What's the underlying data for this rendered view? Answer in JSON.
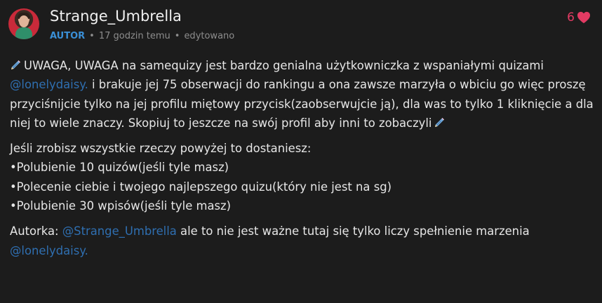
{
  "post": {
    "author": "Strange_Umbrella",
    "role": "AUTOR",
    "time": "17 godzin temu",
    "edited": "edytowano",
    "likes": "6",
    "icons": {
      "like": "heart-icon",
      "decoration": "pencil-icon"
    },
    "colors": {
      "background": "#1c1c1c",
      "mention": "#2f6fb1",
      "role": "#3a8fd6",
      "like": "#e23b63"
    },
    "paragraph1": {
      "text1": "UWAGA, UWAGA na samequizy jest bardzo genialna użytkowniczka z wspaniałymi quizami ",
      "mention": "@lonelydaisy.",
      "text2": " i brakuje jej 75 obserwacji do rankingu a ona zawsze marzyła o wbiciu go więc proszę przyciśnijcie tylko na jej profilu miętowy przycisk(zaobserwujcie ją), dla was to tylko 1 kliknięcie a dla niej to wiele znaczy. Skopiuj to jeszcze na swój profil aby inni to zobaczyli"
    },
    "paragraph2": {
      "intro": "Jeśli zrobisz wszystkie rzeczy powyżej to dostaniesz:",
      "bullets": [
        "•Polubienie 10 quizów(jeśli tyle masz)",
        "•Polecenie ciebie i twojego najlepszego quizu(który nie jest na sg)",
        "•Polubienie 30 wpisów(jeśli tyle masz)"
      ]
    },
    "paragraph3": {
      "text1": "Autorka: ",
      "mention1": "@Strange_Umbrella",
      "text2": " ale to nie jest ważne tutaj się tylko liczy spełnienie marzenia ",
      "mention2": "@lonelydaisy."
    }
  }
}
